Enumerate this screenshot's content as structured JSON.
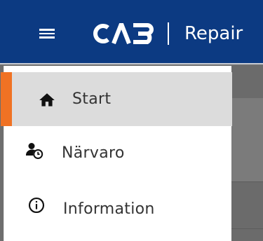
{
  "header": {
    "logo_text": "CAB",
    "app_name": "Repair",
    "menu_icon": "hamburger-menu-icon"
  },
  "drawer": {
    "items": [
      {
        "label": "Start",
        "icon": "home-icon",
        "active": true
      },
      {
        "label": "Närvaro",
        "icon": "person-clock-icon",
        "active": false
      },
      {
        "label": "Information",
        "icon": "info-icon",
        "active": false
      }
    ]
  },
  "colors": {
    "header_bg": "#0c3a82",
    "accent": "#f07224",
    "active_item_bg": "#dcdcdc",
    "overlay": "#6e6e6e"
  }
}
